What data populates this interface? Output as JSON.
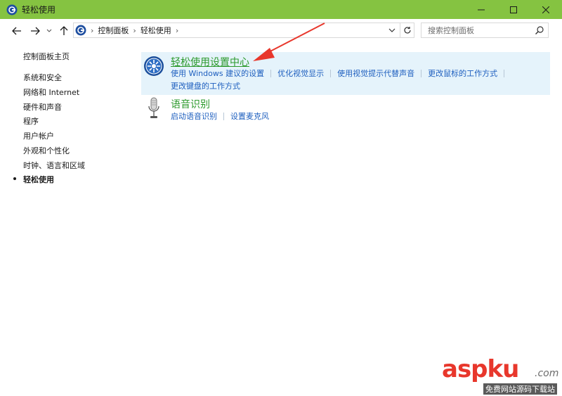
{
  "window": {
    "title": "轻松使用",
    "controls": [
      "minimize",
      "maximize",
      "close"
    ]
  },
  "address": {
    "breadcrumbs": [
      "控制面板",
      "轻松使用"
    ],
    "search_placeholder": "搜索控制面板"
  },
  "leftnav": {
    "home": "控制面板主页",
    "items": [
      {
        "label": "系统和安全",
        "active": false
      },
      {
        "label": "网络和 Internet",
        "active": false
      },
      {
        "label": "硬件和声音",
        "active": false
      },
      {
        "label": "程序",
        "active": false
      },
      {
        "label": "用户帐户",
        "active": false
      },
      {
        "label": "外观和个性化",
        "active": false
      },
      {
        "label": "时钟、语言和区域",
        "active": false
      },
      {
        "label": "轻松使用",
        "active": true
      }
    ]
  },
  "categories": [
    {
      "title": "轻松使用设置中心",
      "icon": "ease-of-access-icon",
      "links": [
        "使用 Windows 建议的设置",
        "优化视觉显示",
        "使用视觉提示代替声音",
        "更改鼠标的工作方式",
        "更改键盘的工作方式"
      ]
    },
    {
      "title": "语音识别",
      "icon": "microphone-icon",
      "links": [
        "启动语音识别",
        "设置麦克风"
      ]
    }
  ],
  "watermark": {
    "text": "aspku",
    "suffix": ".com",
    "sub": "免费网站源码下载站"
  },
  "colors": {
    "titlebar": "#85c341",
    "link": "#1e5fbf",
    "category_title": "#2c9a2c",
    "highlight": "#e5f3fb",
    "annotation_arrow": "#e8372c"
  }
}
